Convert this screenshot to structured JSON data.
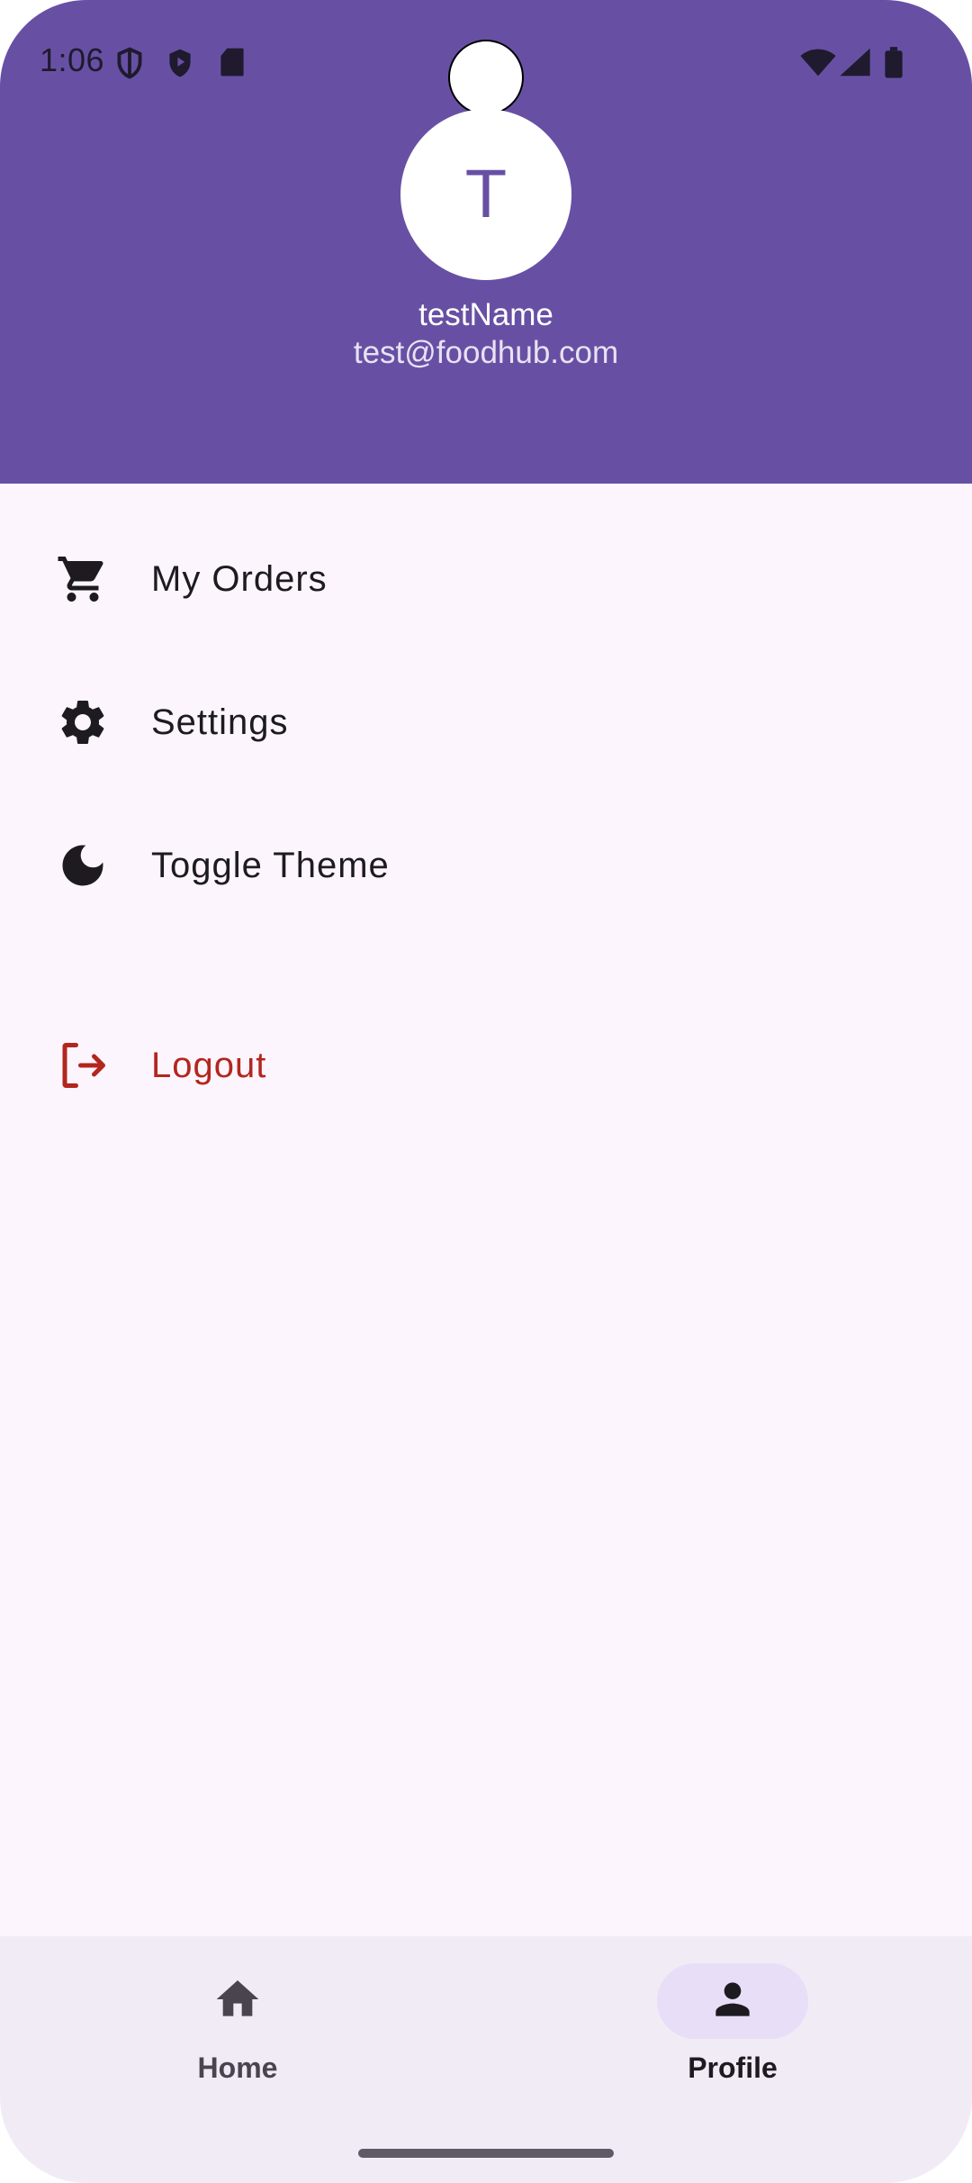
{
  "status_bar": {
    "time": "1:06",
    "icons": [
      "shield-outline-icon",
      "shield-play-icon",
      "sd-card-icon",
      "wifi-icon",
      "signal-icon",
      "battery-icon"
    ]
  },
  "profile": {
    "avatar_initial": "T",
    "name": "testName",
    "email": "test@foodhub.com"
  },
  "menu": {
    "items": [
      {
        "label": "My Orders",
        "icon": "shopping-cart-icon"
      },
      {
        "label": "Settings",
        "icon": "gear-icon"
      },
      {
        "label": "Toggle Theme",
        "icon": "moon-icon"
      }
    ],
    "logout": {
      "label": "Logout",
      "icon": "logout-icon"
    }
  },
  "bottom_nav": {
    "items": [
      {
        "label": "Home",
        "icon": "home-icon",
        "active": false
      },
      {
        "label": "Profile",
        "icon": "person-icon",
        "active": true
      }
    ]
  },
  "colors": {
    "header": "#6750a4",
    "background": "#fcf5fd",
    "logout": "#b3261e",
    "nav_background": "#f1ebf6",
    "nav_active_pill": "#e8def8"
  }
}
